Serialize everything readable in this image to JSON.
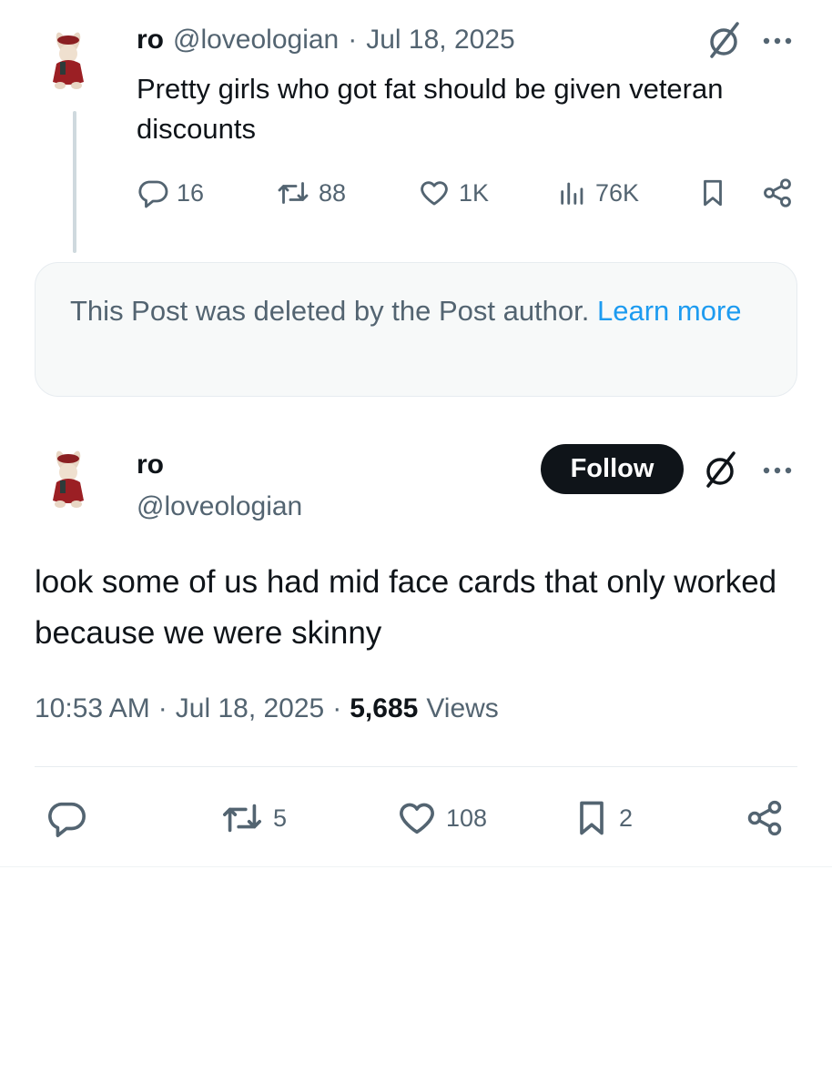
{
  "quoted_post": {
    "author_name": "ro",
    "author_handle": "@loveologian",
    "separator": "·",
    "date": "Jul 18, 2025",
    "text": "Pretty girls who got fat should be given veteran discounts",
    "replies": "16",
    "reposts": "88",
    "likes": "1K",
    "views": "76K"
  },
  "deleted_notice": {
    "text": "This Post was deleted by the Post author.",
    "link": "Learn more"
  },
  "main_post": {
    "author_name": "ro",
    "author_handle": "@loveologian",
    "follow_label": "Follow",
    "text": "look some of us had mid face cards that only worked because we were skinny",
    "time": "10:53 AM",
    "separator": "·",
    "date": "Jul 18, 2025",
    "views_count": "5,685",
    "views_label": "Views",
    "reposts": "5",
    "likes": "108",
    "bookmarks": "2"
  },
  "icons": {
    "more": "more-icon",
    "grok": "grok-icon",
    "reply": "reply-icon",
    "repost": "repost-icon",
    "like": "like-icon",
    "views": "views-icon",
    "bookmark": "bookmark-icon",
    "share": "share-icon"
  },
  "colors": {
    "text_primary": "#0f1419",
    "text_secondary": "#536471",
    "link": "#1d9bf0",
    "follow_bg": "#0f1419"
  }
}
